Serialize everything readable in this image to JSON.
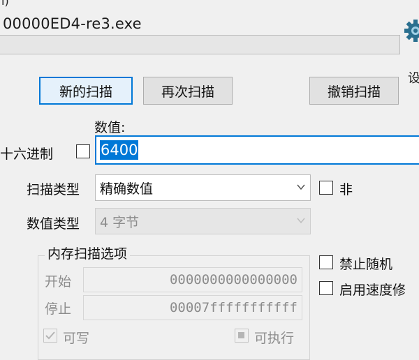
{
  "window": {
    "title_fragment": "l)"
  },
  "process": {
    "title": "00000ED4-re3.exe",
    "progress_fraction": 0
  },
  "settings": {
    "label": "设",
    "icon": "gear-icon"
  },
  "buttons": {
    "new_scan": "新的扫描",
    "next_scan": "再次扫描",
    "undo_scan": "撤销扫描"
  },
  "value": {
    "label": "数值:",
    "hex_label": "十六进制",
    "input": "6400",
    "hex_checked": false
  },
  "scan_type": {
    "label": "扫描类型",
    "selected": "精确数值",
    "not_label": "非",
    "not_checked": false
  },
  "value_type": {
    "label": "数值类型",
    "selected": "4 字节"
  },
  "memory_options": {
    "title": "内存扫描选项",
    "start_label": "开始",
    "start_value": "0000000000000000",
    "stop_label": "停止",
    "stop_value": "00007fffffffffff",
    "writable_label": "可写",
    "writable_checked": true,
    "executable_label": "可执行",
    "executable_state": "indeterminate"
  },
  "options": {
    "disable_random": "禁止随机",
    "enable_speedhack": "启用速度修"
  },
  "colors": {
    "accent": "#0078d7",
    "progress": "#06b025",
    "disabled_text": "#8c8c8c"
  }
}
